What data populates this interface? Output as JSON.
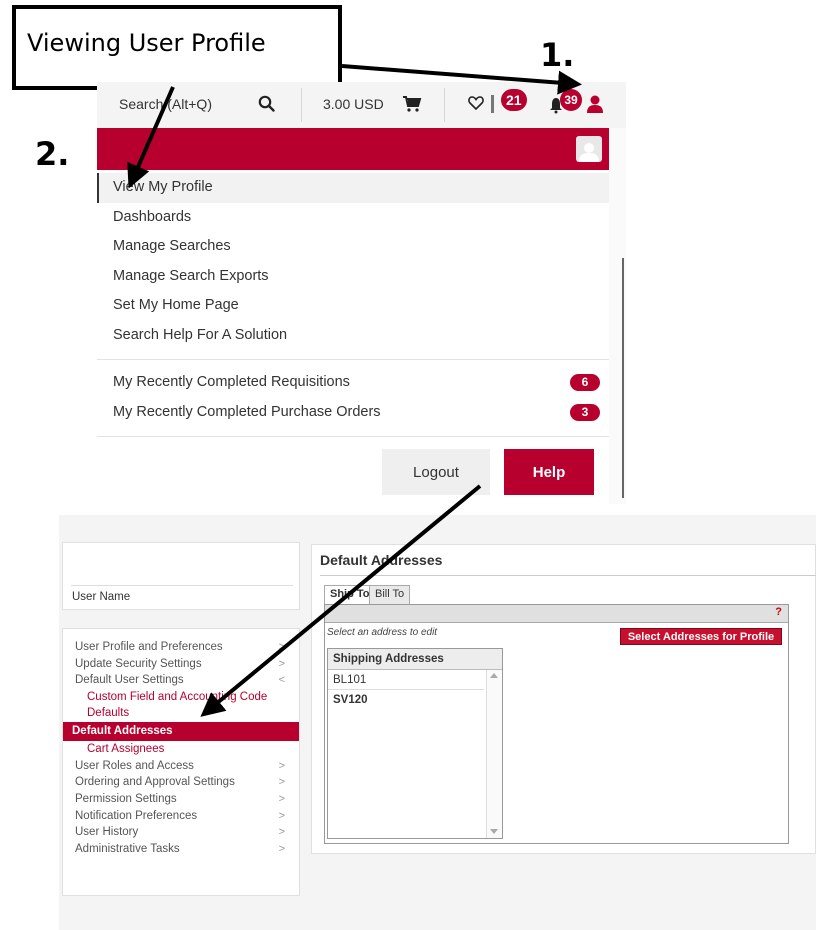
{
  "annotation": {
    "callout": "Viewing User Profile",
    "step_one": "1.",
    "step_two": "2."
  },
  "topbar": {
    "search_label": "Search (Alt+Q)",
    "cart_total": "3.00 USD",
    "favorites_badge": "21",
    "notifications_badge": "39"
  },
  "user_menu": {
    "items": [
      "View My Profile",
      "Dashboards",
      "Manage Searches",
      "Manage Search Exports",
      "Set My Home Page",
      "Search Help For A Solution"
    ],
    "recent": [
      {
        "label": "My Recently Completed Requisitions",
        "count": "6"
      },
      {
        "label": "My Recently Completed Purchase Orders",
        "count": "3"
      }
    ],
    "logout_label": "Logout",
    "help_label": "Help"
  },
  "profile_page": {
    "user_name_label": "User Name",
    "nav": {
      "user_profile": "User Profile and Preferences",
      "security": "Update Security Settings",
      "default_settings": "Default User Settings",
      "custom_field": "Custom Field and Accounting Code Defaults",
      "default_addresses": "Default Addresses",
      "cart_assignees": "Cart Assignees",
      "roles": "User Roles and Access",
      "ordering": "Ordering and Approval Settings",
      "permissions": "Permission Settings",
      "notifications": "Notification Preferences",
      "history": "User History",
      "admin": "Administrative Tasks"
    },
    "main": {
      "title": "Default Addresses",
      "tab_ship": "Ship To",
      "tab_bill": "Bill To",
      "help_mark": "?",
      "hint": "Select an address to edit",
      "select_button": "Select Addresses for Profile",
      "list_header": "Shipping Addresses",
      "addresses": [
        "BL101",
        "SV120"
      ]
    }
  },
  "colors": {
    "brand_red": "#b8002e",
    "button_red": "#c8102e"
  }
}
